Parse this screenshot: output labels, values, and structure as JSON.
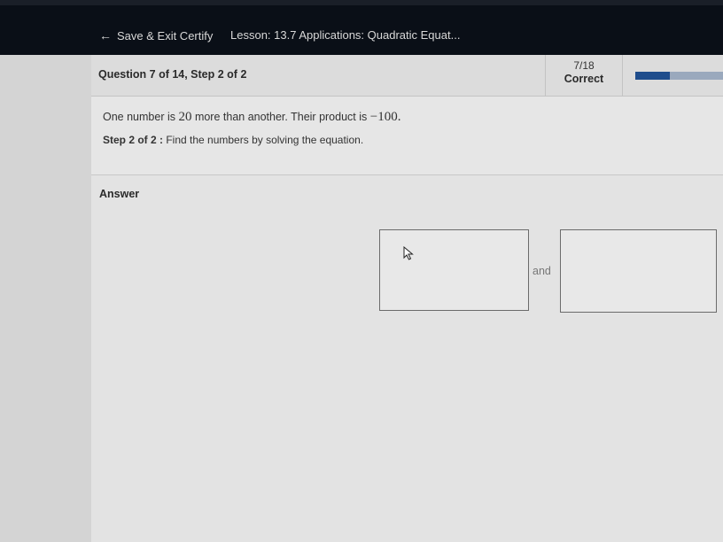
{
  "header": {
    "back_label": "Save & Exit Certify",
    "lesson_title": "Lesson: 13.7 Applications: Quadratic Equat..."
  },
  "question": {
    "title": "Question 7 of 14, Step 2 of 2",
    "score_fraction": "7/18",
    "score_label": "Correct",
    "progress_fraction": 0.39
  },
  "problem": {
    "statement_pre": "One number is ",
    "statement_num1": "20",
    "statement_mid": " more than another. Their product is ",
    "statement_num2": "−100.",
    "step_label": "Step 2 of 2 :",
    "step_text": " Find the numbers by solving the equation."
  },
  "answer": {
    "label": "Answer",
    "first_value": "",
    "connector": "and",
    "second_value": ""
  },
  "icons": {
    "back": "left-arrow-icon",
    "cursor": "mouse-pointer-icon"
  },
  "colors": {
    "topbar": "#0a0f17",
    "progress_fill": "#1f4d8c",
    "progress_track": "#9aa9bd"
  }
}
